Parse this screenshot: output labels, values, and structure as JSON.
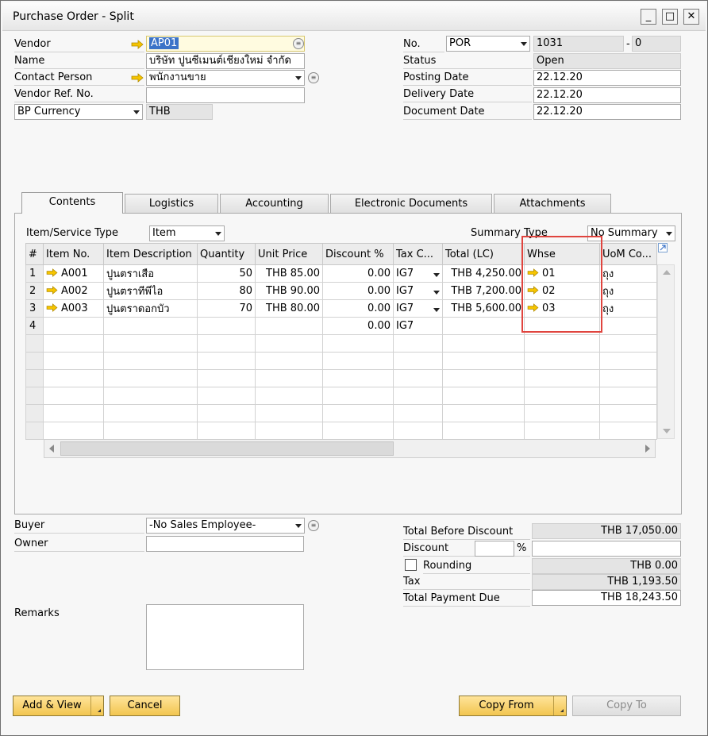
{
  "window": {
    "title": "Purchase Order - Split",
    "min": "_",
    "max": "□",
    "close": "✕"
  },
  "header": {
    "vendor_label": "Vendor",
    "vendor_value": "AP01",
    "name_label": "Name",
    "name_value": "บริษัท ปูนซีเมนต์เชียงใหม่ จำกัด",
    "contact_label": "Contact Person",
    "contact_value": "พนักงานขาย",
    "vendor_ref_label": "Vendor Ref. No.",
    "vendor_ref_value": "",
    "currency_select": "BP Currency",
    "currency_value": "THB",
    "no_label": "No.",
    "series": "POR",
    "doc_no": "1031",
    "dash": "-",
    "doc_sub": "0",
    "status_label": "Status",
    "status_value": "Open",
    "posting_label": "Posting Date",
    "posting_value": "22.12.20",
    "delivery_label": "Delivery Date",
    "delivery_value": "22.12.20",
    "document_label": "Document Date",
    "document_value": "22.12.20"
  },
  "tabs": [
    "Contents",
    "Logistics",
    "Accounting",
    "Electronic Documents",
    "Attachments"
  ],
  "contents": {
    "item_type_label": "Item/Service Type",
    "item_type_value": "Item",
    "summary_label": "Summary Type",
    "summary_value": "No Summary",
    "columns": [
      "#",
      "Item No.",
      "Item Description",
      "Quantity",
      "Unit Price",
      "Discount %",
      "Tax C...",
      "Total (LC)",
      "Whse",
      "UoM Co..."
    ],
    "rows": [
      {
        "n": "1",
        "item": "A001",
        "desc": "ปูนตราเสือ",
        "qty": "50",
        "price": "THB 85.00",
        "disc": "0.00",
        "tax": "IG7",
        "total": "THB 4,250.00",
        "whse": "01",
        "uom": "ถุง"
      },
      {
        "n": "2",
        "item": "A002",
        "desc": "ปูนตราทีพีไอ",
        "qty": "80",
        "price": "THB 90.00",
        "disc": "0.00",
        "tax": "IG7",
        "total": "THB 7,200.00",
        "whse": "02",
        "uom": "ถุง"
      },
      {
        "n": "3",
        "item": "A003",
        "desc": "ปูนตราดอกบัว",
        "qty": "70",
        "price": "THB 80.00",
        "disc": "0.00",
        "tax": "IG7",
        "total": "THB 5,600.00",
        "whse": "03",
        "uom": "ถุง"
      },
      {
        "n": "4",
        "item": "",
        "desc": "",
        "qty": "",
        "price": "",
        "disc": "0.00",
        "tax": "IG7",
        "total": "",
        "whse": "",
        "uom": ""
      }
    ]
  },
  "footer": {
    "buyer_label": "Buyer",
    "buyer_value": "-No Sales Employee-",
    "owner_label": "Owner",
    "owner_value": "",
    "remarks_label": "Remarks",
    "tbd_label": "Total Before Discount",
    "tbd_value": "THB 17,050.00",
    "discount_label": "Discount",
    "percent": "%",
    "rounding_label": "Rounding",
    "rounding_value": "THB 0.00",
    "tax_label": "Tax",
    "tax_value": "THB 1,193.50",
    "due_label": "Total Payment Due",
    "due_value": "THB 18,243.50"
  },
  "buttons": {
    "add_view": "Add & View",
    "cancel": "Cancel",
    "copy_from": "Copy From",
    "copy_to": "Copy To"
  },
  "colors": {
    "accent": "#3b73c8",
    "button": "#f2c54f",
    "highlight": "#e0443e",
    "link_arrow": "#f2b600"
  }
}
